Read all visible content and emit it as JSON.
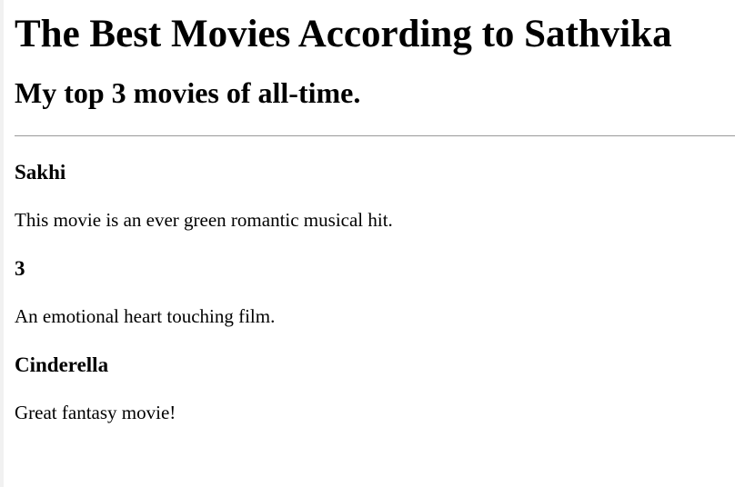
{
  "page": {
    "title": "The Best Movies According to Sathvika",
    "subtitle": "My top 3 movies of all-time."
  },
  "movies": [
    {
      "title": "Sakhi",
      "description": "This movie is an ever green romantic musical hit."
    },
    {
      "title": "3",
      "description": "An emotional heart touching film."
    },
    {
      "title": "Cinderella",
      "description": "Great fantasy movie!"
    }
  ]
}
